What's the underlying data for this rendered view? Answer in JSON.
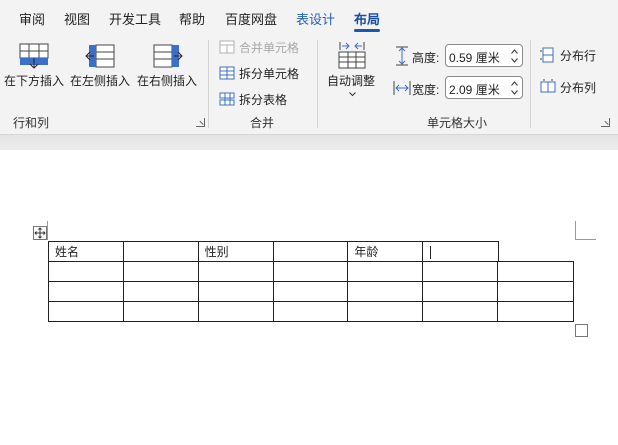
{
  "tabs": [
    "审阅",
    "视图",
    "开发工具",
    "帮助",
    "百度网盘",
    "表设计",
    "布局"
  ],
  "groups": {
    "rows_cols": {
      "label": "行和列",
      "insert_below": "在下方插入",
      "insert_left": "在左侧插入",
      "insert_right": "在右侧插入"
    },
    "merge": {
      "label": "合并",
      "merge_cells": "合并单元格",
      "split_cells": "拆分单元格",
      "split_table": "拆分表格"
    },
    "cell_size": {
      "label": "单元格大小",
      "autofit": "自动调整",
      "height_label": "高度:",
      "height_value": "0.59 厘米",
      "width_label": "宽度:",
      "width_value": "2.09 厘米",
      "distribute_rows": "分布行",
      "distribute_cols": "分布列"
    }
  },
  "table": {
    "header_row": [
      "姓名",
      "",
      "性别",
      "",
      "年龄",
      "",
      ""
    ]
  },
  "colors": {
    "accent": "#1a57b0",
    "contextual_tab": "#2561b8",
    "icon_blue": "#3c6fc8"
  }
}
